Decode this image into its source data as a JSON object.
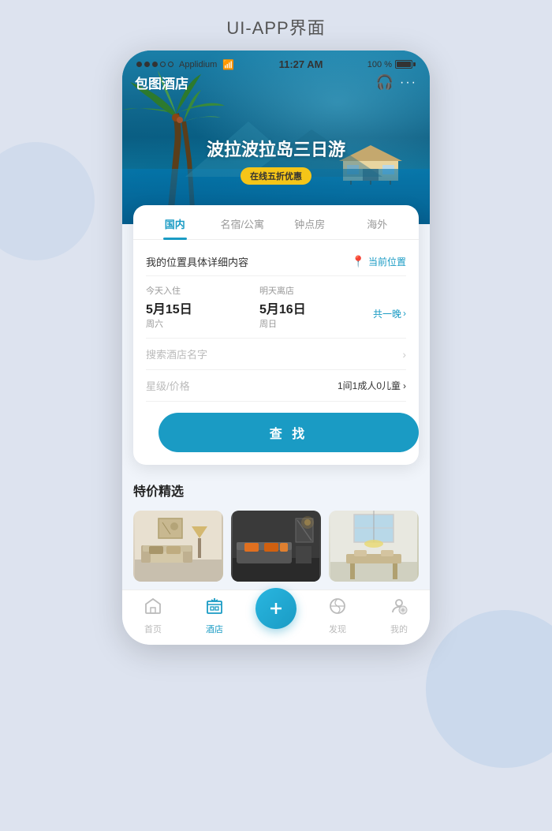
{
  "page": {
    "title": "UI-APP界面"
  },
  "status_bar": {
    "dots_filled": 3,
    "dots_empty": 2,
    "carrier": "Applidium",
    "wifi": "WiFi",
    "time": "11:27 AM",
    "battery": "100 %"
  },
  "header": {
    "logo": "包图酒店",
    "dots": "···"
  },
  "hero": {
    "title": "波拉波拉岛三日游",
    "badge": "在线五折优惠"
  },
  "tabs": [
    {
      "label": "国内",
      "active": true
    },
    {
      "label": "名宿/公寓",
      "active": false
    },
    {
      "label": "钟点房",
      "active": false
    },
    {
      "label": "海外",
      "active": false
    }
  ],
  "form": {
    "location_placeholder": "我的位置具体详细内容",
    "current_location_label": "当前位置",
    "checkin_label": "今天入住",
    "checkin_date": "5月15日",
    "checkin_day": "周六",
    "checkout_label": "明天离店",
    "checkout_date": "5月16日",
    "checkout_day": "周日",
    "nights_label": "共一晚",
    "hotel_name_placeholder": "搜索酒店名字",
    "filter_label": "星级/价格",
    "filter_value": "1间1成人0儿童",
    "search_button": "查 找"
  },
  "offers": {
    "section_title": "特价精选",
    "items": [
      {
        "id": 1,
        "type": "living-room"
      },
      {
        "id": 2,
        "type": "dark-room"
      },
      {
        "id": 3,
        "type": "kitchen"
      }
    ]
  },
  "bottom_nav": {
    "items": [
      {
        "label": "首页",
        "icon": "home",
        "active": false
      },
      {
        "label": "酒店",
        "icon": "hotel",
        "active": true
      },
      {
        "label": "+",
        "icon": "plus",
        "active": false,
        "is_plus": true
      },
      {
        "label": "发现",
        "icon": "discover",
        "active": false
      },
      {
        "label": "我的",
        "icon": "profile",
        "active": false
      }
    ]
  }
}
